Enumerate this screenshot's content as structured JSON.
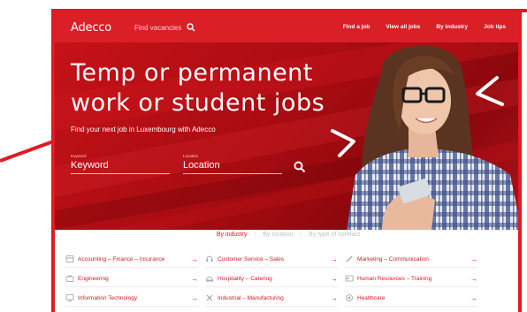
{
  "nav": {
    "logo": "Adecco",
    "search_label": "Find vacancies",
    "links": [
      "Find a job",
      "View all jobs",
      "By industry",
      "Job tips"
    ]
  },
  "hero": {
    "title_line1": "Temp or permanent",
    "title_line2": "work or student jobs",
    "subtitle": "Find your next job in Luxembourg with Adecco",
    "keyword_label": "Keyword",
    "keyword_value": "Keyword",
    "location_label": "Location",
    "location_value": "Location"
  },
  "filters": {
    "by_industry": "By industry",
    "by_location": "By location",
    "by_type": "By type of contract"
  },
  "categories": [
    {
      "label": "Accounting – Finance – Insurance",
      "icon": "calculator-icon"
    },
    {
      "label": "Customer Service – Sales",
      "icon": "headset-icon"
    },
    {
      "label": "Marketing – Communication",
      "icon": "pen-icon"
    },
    {
      "label": "Engineering",
      "icon": "toolbox-icon"
    },
    {
      "label": "Hospitality – Catering",
      "icon": "cloche-icon"
    },
    {
      "label": "Human Resources – Training",
      "icon": "id-card-icon"
    },
    {
      "label": "Information Technology",
      "icon": "monitor-icon"
    },
    {
      "label": "Industrial – Manufacturing",
      "icon": "tools-icon"
    },
    {
      "label": "Healthcare",
      "icon": "health-icon"
    }
  ],
  "arrow": "→",
  "colors": {
    "brand_red": "#da1f27",
    "dark_red": "#8a070c",
    "text_red": "#d31a22"
  }
}
